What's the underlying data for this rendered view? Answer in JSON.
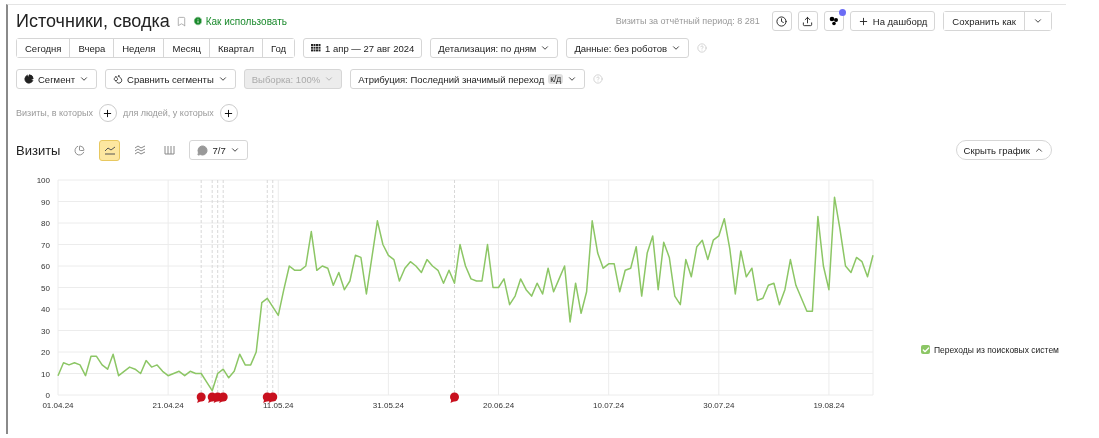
{
  "header": {
    "title": "Источники, сводка",
    "help_link": "Как использовать",
    "visits_total": "Визиты за отчётный период: 8 281",
    "dashboard_button": "На дашборд",
    "save_button": "Сохранить как"
  },
  "periods": [
    "Сегодня",
    "Вчера",
    "Неделя",
    "Месяц",
    "Квартал",
    "Год"
  ],
  "date_range": "1 апр — 27 авг 2024",
  "dropdowns": [
    "Детализация: по дням",
    "Данные: без роботов"
  ],
  "segment_controls": [
    {
      "kind": "segment",
      "label": "Сегмент",
      "disabled": false
    },
    {
      "kind": "compare",
      "label": "Сравнить сегменты",
      "disabled": false
    },
    {
      "kind": "sample",
      "label": "Выборка: 100%",
      "disabled": true
    },
    {
      "kind": "attribution",
      "label": "Атрибуция: Последний значимый переход",
      "badge": "к/д",
      "disabled": false
    }
  ],
  "filters": [
    "Визиты, в которых",
    "для людей, у которых"
  ],
  "chart_header": {
    "title": "Визиты",
    "views": [
      {
        "kind": "pie",
        "selected": false
      },
      {
        "kind": "line",
        "selected": true
      },
      {
        "kind": "area",
        "selected": false
      },
      {
        "kind": "table",
        "selected": false
      }
    ],
    "comments": "7/7",
    "hide_button": "Скрыть график"
  },
  "legend": [
    {
      "checked": true
    }
  ],
  "chart_data": {
    "type": "line",
    "grid": true,
    "ylim": [
      0,
      100
    ],
    "yticks": [
      0,
      10,
      20,
      30,
      40,
      50,
      60,
      70,
      80,
      90,
      100
    ],
    "categories": [
      "01.04.24",
      null,
      null,
      null,
      null,
      null,
      null,
      null,
      null,
      null,
      null,
      null,
      null,
      null,
      null,
      null,
      null,
      null,
      null,
      null,
      "21.04.24",
      null,
      null,
      null,
      null,
      null,
      null,
      null,
      null,
      null,
      null,
      null,
      null,
      null,
      null,
      null,
      null,
      null,
      null,
      null,
      "11.05.24",
      null,
      null,
      null,
      null,
      null,
      null,
      null,
      null,
      null,
      null,
      null,
      null,
      null,
      null,
      null,
      null,
      null,
      null,
      null,
      "31.05.24",
      null,
      null,
      null,
      null,
      null,
      null,
      null,
      null,
      null,
      null,
      null,
      null,
      null,
      null,
      null,
      null,
      null,
      null,
      null,
      "20.06.24",
      null,
      null,
      null,
      null,
      null,
      null,
      null,
      null,
      null,
      null,
      null,
      null,
      null,
      null,
      null,
      null,
      null,
      null,
      null,
      "10.07.24",
      null,
      null,
      null,
      null,
      null,
      null,
      null,
      null,
      null,
      null,
      null,
      null,
      null,
      null,
      null,
      null,
      null,
      null,
      null,
      "30.07.24",
      null,
      null,
      null,
      null,
      null,
      null,
      null,
      null,
      null,
      null,
      null,
      null,
      null,
      null,
      null,
      null,
      null,
      null,
      null,
      "19.08.24",
      null,
      null,
      null,
      null,
      null,
      null,
      null,
      null
    ],
    "series": [
      {
        "name": "Переходы из поисковых систем",
        "color": "#8cc665",
        "values": [
          9,
          15,
          14,
          15,
          14,
          9,
          18,
          18,
          14,
          12,
          19,
          9,
          11,
          13,
          12,
          10,
          16,
          13,
          14,
          11,
          9,
          10,
          11,
          9,
          11,
          10,
          10,
          6,
          2,
          10,
          12,
          8,
          11,
          19,
          14,
          14,
          20,
          43,
          45,
          41,
          37,
          49,
          60,
          58,
          58,
          60,
          76,
          58,
          60,
          59,
          51,
          57,
          49,
          53,
          65,
          64,
          47,
          64,
          81,
          70,
          65,
          63,
          53,
          59,
          62,
          60,
          57,
          63,
          60,
          58,
          52,
          58,
          52,
          70,
          60,
          54,
          53,
          53,
          70,
          50,
          50,
          54,
          42,
          46,
          54,
          49,
          46,
          52,
          47,
          59,
          48,
          54,
          60,
          34,
          52,
          38,
          48,
          81,
          66,
          59,
          61,
          61,
          48,
          58,
          59,
          69,
          46,
          66,
          74,
          49,
          71,
          64,
          46,
          42,
          63,
          55,
          69,
          72,
          63,
          72,
          74,
          82,
          68,
          47,
          67,
          55,
          59,
          44,
          45,
          51,
          52,
          42,
          49,
          63,
          51,
          45,
          39,
          39,
          83,
          60,
          49,
          92,
          77,
          60,
          57,
          64,
          62,
          55,
          65
        ]
      }
    ]
  }
}
